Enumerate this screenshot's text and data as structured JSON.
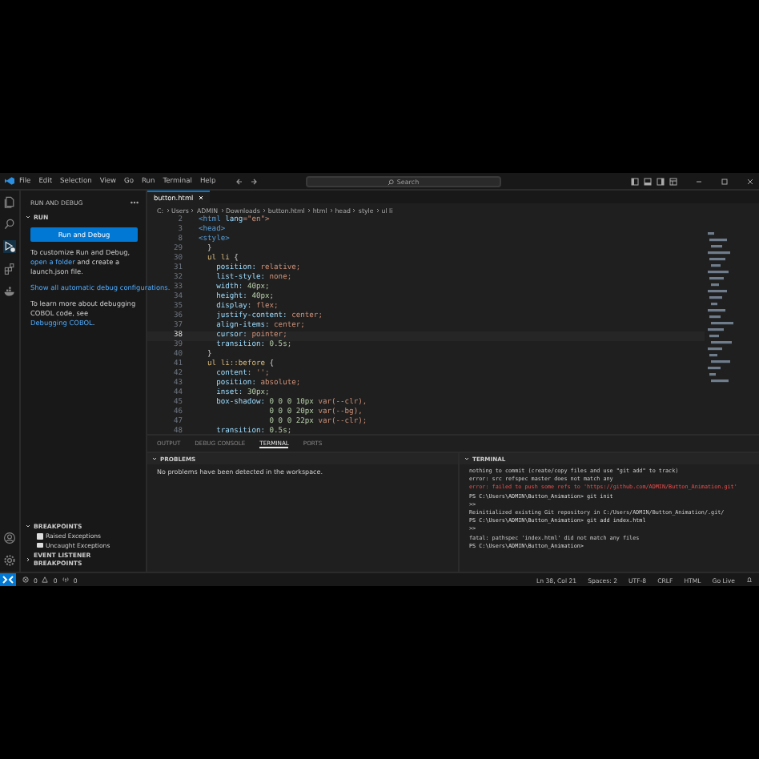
{
  "title_bar": {
    "menu": [
      "File",
      "Edit",
      "Selection",
      "View",
      "Go",
      "Run",
      "Terminal",
      "Help"
    ],
    "search": {
      "placeholder": "Search"
    }
  },
  "activity_bar": {
    "items": [
      {
        "kind": "files",
        "selected": false
      },
      {
        "kind": "search",
        "selected": false
      },
      {
        "kind": "debug",
        "selected": true
      },
      {
        "kind": "extensions",
        "selected": false
      },
      {
        "kind": "remote",
        "selected": false
      }
    ],
    "bottom": [
      {
        "kind": "account"
      },
      {
        "kind": "settings"
      }
    ]
  },
  "sidebar": {
    "title": "RUN AND DEBUG",
    "section": "RUN",
    "button": "Run and Debug",
    "paragraphs": [
      [
        {
          "text": "To customize Run and Debug, ",
          "link": false
        },
        {
          "text": "open a folder",
          "link": true
        },
        {
          "text": " and create a launch.json file.",
          "link": false
        }
      ],
      [
        {
          "text": "Show all automatic debug configurations.",
          "link": true
        }
      ],
      [
        {
          "text": "To learn more about debugging COBOL code, see ",
          "link": false
        },
        {
          "text": "Debugging COBOL",
          "link": true
        },
        {
          "text": ".",
          "link": false
        }
      ]
    ],
    "breakpoints": {
      "title": "BREAKPOINTS",
      "expanded": true,
      "items": [
        {
          "label": "Raised Exceptions",
          "checked": false
        },
        {
          "label": "Uncaught Exceptions",
          "checked": false
        }
      ]
    },
    "event_breakpoints": {
      "title": "EVENT LISTENER BREAKPOINTS",
      "expanded": false
    }
  },
  "editor": {
    "tabs": [
      {
        "label": "button.html",
        "selected": true
      }
    ],
    "breadcrumbs": [
      "C:",
      "Users",
      "ADMIN",
      "Downloads",
      "button.html",
      "html",
      "head",
      "style",
      "ul li"
    ],
    "lines": [
      {
        "number": "2",
        "current": false,
        "tokens": [
          {
            "text": "<html ",
            "kind": "tag"
          },
          {
            "text": "lang",
            "kind": "attr"
          },
          {
            "text": "=\"en\">",
            "kind": "string"
          }
        ]
      },
      {
        "number": "3",
        "current": false,
        "tokens": [
          {
            "text": "<head>",
            "kind": "tag"
          }
        ]
      },
      {
        "number": "8",
        "current": false,
        "tokens": [
          {
            "text": "<style>",
            "kind": "tag"
          }
        ]
      },
      {
        "number": "29",
        "current": false,
        "tokens": [
          {
            "text": "  }",
            "kind": "punct"
          }
        ]
      },
      {
        "number": "30",
        "current": false,
        "tokens": [
          {
            "text": "  ul li ",
            "kind": "selector"
          },
          {
            "text": "{",
            "kind": "punct"
          }
        ]
      },
      {
        "number": "31",
        "current": false,
        "tokens": [
          {
            "text": "    position: ",
            "kind": "prop"
          },
          {
            "text": "relative;",
            "kind": "value"
          }
        ]
      },
      {
        "number": "32",
        "current": false,
        "tokens": [
          {
            "text": "    list-style: ",
            "kind": "prop"
          },
          {
            "text": "none;",
            "kind": "value"
          }
        ]
      },
      {
        "number": "33",
        "current": false,
        "tokens": [
          {
            "text": "    width: ",
            "kind": "prop"
          },
          {
            "text": "40px;",
            "kind": "number"
          }
        ]
      },
      {
        "number": "34",
        "current": false,
        "tokens": [
          {
            "text": "    height: ",
            "kind": "prop"
          },
          {
            "text": "40px;",
            "kind": "number"
          }
        ]
      },
      {
        "number": "35",
        "current": false,
        "tokens": [
          {
            "text": "    display: ",
            "kind": "prop"
          },
          {
            "text": "flex;",
            "kind": "value"
          }
        ]
      },
      {
        "number": "36",
        "current": false,
        "tokens": [
          {
            "text": "    justify-content: ",
            "kind": "prop"
          },
          {
            "text": "center;",
            "kind": "value"
          }
        ]
      },
      {
        "number": "37",
        "current": false,
        "tokens": [
          {
            "text": "    align-items: ",
            "kind": "prop"
          },
          {
            "text": "center;",
            "kind": "value"
          }
        ]
      },
      {
        "number": "38",
        "current": true,
        "tokens": [
          {
            "text": "    cursor: ",
            "kind": "prop"
          },
          {
            "text": "pointer;",
            "kind": "value"
          }
        ]
      },
      {
        "number": "39",
        "current": false,
        "tokens": [
          {
            "text": "    transition: ",
            "kind": "prop"
          },
          {
            "text": "0.5s;",
            "kind": "number"
          }
        ]
      },
      {
        "number": "40",
        "current": false,
        "tokens": [
          {
            "text": "  }",
            "kind": "punct"
          }
        ]
      },
      {
        "number": "41",
        "current": false,
        "tokens": [
          {
            "text": "  ul li::before ",
            "kind": "selector"
          },
          {
            "text": "{",
            "kind": "punct"
          }
        ]
      },
      {
        "number": "42",
        "current": false,
        "tokens": [
          {
            "text": "    content: ",
            "kind": "prop"
          },
          {
            "text": "'';",
            "kind": "string"
          }
        ]
      },
      {
        "number": "43",
        "current": false,
        "tokens": [
          {
            "text": "    position: ",
            "kind": "prop"
          },
          {
            "text": "absolute;",
            "kind": "value"
          }
        ]
      },
      {
        "number": "44",
        "current": false,
        "tokens": [
          {
            "text": "    inset: ",
            "kind": "prop"
          },
          {
            "text": "30px;",
            "kind": "number"
          }
        ]
      },
      {
        "number": "45",
        "current": false,
        "tokens": [
          {
            "text": "    box-shadow: ",
            "kind": "prop"
          },
          {
            "text": "0 0 0 10px ",
            "kind": "number"
          },
          {
            "text": "var(--clr),",
            "kind": "value"
          }
        ]
      },
      {
        "number": "46",
        "current": false,
        "tokens": [
          {
            "text": "                0 0 0 20px ",
            "kind": "number"
          },
          {
            "text": "var(--bg),",
            "kind": "value"
          }
        ]
      },
      {
        "number": "47",
        "current": false,
        "tokens": [
          {
            "text": "                0 0 0 22px ",
            "kind": "number"
          },
          {
            "text": "var(--clr);",
            "kind": "value"
          }
        ]
      },
      {
        "number": "48",
        "current": false,
        "tokens": [
          {
            "text": "    transition: ",
            "kind": "prop"
          },
          {
            "text": "0.5s;",
            "kind": "number"
          }
        ]
      }
    ]
  },
  "panel": {
    "tabs": [
      {
        "label": "OUTPUT",
        "selected": false
      },
      {
        "label": "DEBUG CONSOLE",
        "selected": false
      },
      {
        "label": "TERMINAL",
        "selected": true
      },
      {
        "label": "PORTS",
        "selected": false
      }
    ],
    "problems": {
      "title": "PROBLEMS",
      "message": "No problems have been detected in the workspace."
    },
    "terminal": {
      "title": "TERMINAL",
      "lines": [
        {
          "text": "nothing to commit (create/copy files and use \"git add\" to track)",
          "kind": "output"
        },
        {
          "text": "error: src refspec master does not match any",
          "kind": "output"
        },
        {
          "text": "error: failed to push some refs to 'https://github.com/ADMIN/Button_Animation.git'",
          "kind": "error"
        },
        {
          "text": "PS C:\\Users\\ADMIN\\Button_Animation> git init",
          "kind": "prompt"
        },
        {
          "text": ">>",
          "kind": "output"
        },
        {
          "text": "Reinitialized existing Git repository in C:/Users/ADMIN/Button_Animation/.git/",
          "kind": "output"
        },
        {
          "text": "PS C:\\Users\\ADMIN\\Button_Animation> git add index.html",
          "kind": "prompt"
        },
        {
          "text": ">>",
          "kind": "output"
        },
        {
          "text": "fatal: pathspec 'index.html' did not match any files",
          "kind": "output"
        },
        {
          "text": "PS C:\\Users\\ADMIN\\Button_Animation>",
          "kind": "prompt"
        }
      ]
    }
  },
  "status_bar": {
    "left": [
      {
        "kind": "error",
        "text": "0"
      },
      {
        "kind": "warning",
        "text": "0"
      },
      {
        "kind": "ports",
        "text": "0"
      }
    ],
    "right": [
      "Ln 38, Col 21",
      "Spaces: 2",
      "UTF-8",
      "CRLF",
      "HTML",
      "Go Live"
    ]
  }
}
